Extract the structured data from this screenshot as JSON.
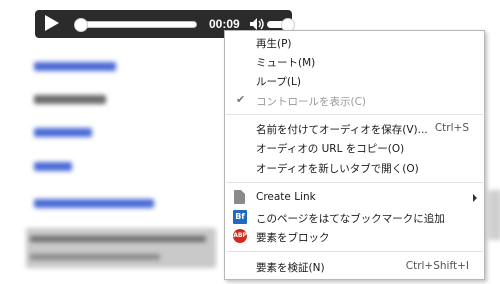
{
  "player": {
    "time": "00:09",
    "progress_fraction": 0.03,
    "volume_fraction": 0.85
  },
  "menu": {
    "items": [
      {
        "label": "再生(P)"
      },
      {
        "label": "ミュート(M)"
      },
      {
        "label": "ループ(L)"
      },
      {
        "label": "コントロールを表示(C)",
        "checked": true,
        "disabled": true
      },
      {
        "label": "名前を付けてオーディオを保存(V)...",
        "shortcut": "Ctrl+S"
      },
      {
        "label": "オーディオの URL をコピー(O)"
      },
      {
        "label": "オーディオを新しいタブで開く(O)"
      },
      {
        "label": "Create Link",
        "icon": "document-icon",
        "submenu": true
      },
      {
        "label": "このページをはてなブックマークに追加",
        "icon": "hatena-bookmark-icon",
        "icon_text": "Bf"
      },
      {
        "label": "要素をブロック",
        "icon": "adblock-plus-icon",
        "icon_text": "ABP"
      },
      {
        "label": "要素を検証(N)",
        "shortcut": "Ctrl+Shift+I"
      }
    ]
  },
  "colors": {
    "player_bg": "#2b2b2b",
    "blurred_link": "#3b5bcc",
    "disabled_text": "#999999"
  }
}
